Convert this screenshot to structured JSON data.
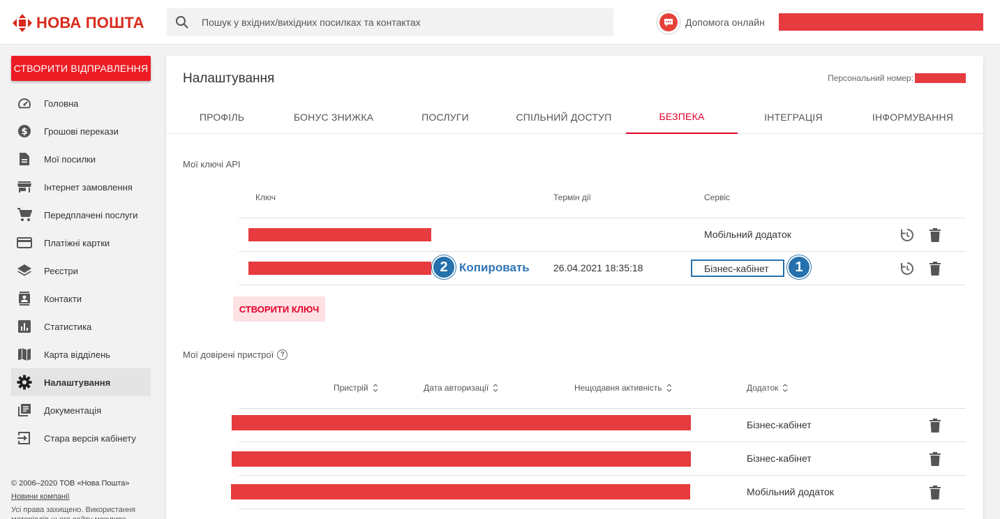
{
  "header": {
    "logo_text": "НОВА ПОШТА",
    "search_placeholder": "Пошук у вхідних/вихідних посилках та контактах",
    "help_label": "Допомога онлайн",
    "brand_color": "#da291c"
  },
  "sidebar": {
    "create_button": "СТВОРИТИ ВІДПРАВЛЕННЯ",
    "items": [
      {
        "label": "Головна",
        "icon": "dashboard-icon"
      },
      {
        "label": "Грошові перекази",
        "icon": "dollar-icon"
      },
      {
        "label": "Мої посилки",
        "icon": "document-icon"
      },
      {
        "label": "Інтернет замовлення",
        "icon": "store-icon"
      },
      {
        "label": "Передплачені послуги",
        "icon": "cart-icon"
      },
      {
        "label": "Платіжні картки",
        "icon": "credit-card-icon"
      },
      {
        "label": "Реєстри",
        "icon": "layers-icon"
      },
      {
        "label": "Контакти",
        "icon": "contacts-icon"
      },
      {
        "label": "Статистика",
        "icon": "chart-icon"
      },
      {
        "label": "Карта відділень",
        "icon": "map-icon"
      },
      {
        "label": "Налаштування",
        "icon": "gear-icon",
        "active": true
      },
      {
        "label": "Документація",
        "icon": "library-icon"
      },
      {
        "label": "Стара версія кабінету",
        "icon": "login-icon"
      }
    ],
    "footer": {
      "copyright": "© 2006–2020 ТОВ «Нова Пошта»",
      "news_link": "Новини компанії",
      "rights": "Усі права захищено. Використання матеріалів цього сайту можливе"
    }
  },
  "main": {
    "title": "Налаштування",
    "personal_number_label": "Персональний номер:",
    "tabs": [
      {
        "label": "ПРОФІЛЬ"
      },
      {
        "label": "БОНУС ЗНИЖКА"
      },
      {
        "label": "ПОСЛУГИ"
      },
      {
        "label": "СПІЛЬНИЙ ДОСТУП"
      },
      {
        "label": "БЕЗПЕКА",
        "active": true
      },
      {
        "label": "ІНТЕГРАЦІЯ"
      },
      {
        "label": "ІНФОРМУВАННЯ"
      }
    ],
    "api_keys": {
      "title": "Мої ключі API",
      "columns": {
        "key": "Ключ",
        "term": "Термін дії",
        "service": "Сервіс"
      },
      "rows": [
        {
          "term": "",
          "service": "Мобільний додаток"
        },
        {
          "term": "26.04.2021 18:35:18",
          "service": "Бізнес-кабінет"
        }
      ],
      "create_button": "СТВОРИТИ КЛЮЧ",
      "copy_link": "Копировать",
      "callout_1": "1",
      "callout_2": "2"
    },
    "devices": {
      "title": "Мої довірені пристрої",
      "columns": {
        "device": "Пристрій",
        "auth_date": "Дата авторизації",
        "activity": "Нещодавня активність",
        "app": "Додаток"
      },
      "rows": [
        {
          "app": "Бізнес-кабінет"
        },
        {
          "app": "Бізнес-кабінет"
        },
        {
          "app": "Мобільний додаток"
        }
      ]
    }
  },
  "colors": {
    "accent": "#e4002b",
    "redaction": "#e63b3f",
    "callout": "#2471ad"
  }
}
